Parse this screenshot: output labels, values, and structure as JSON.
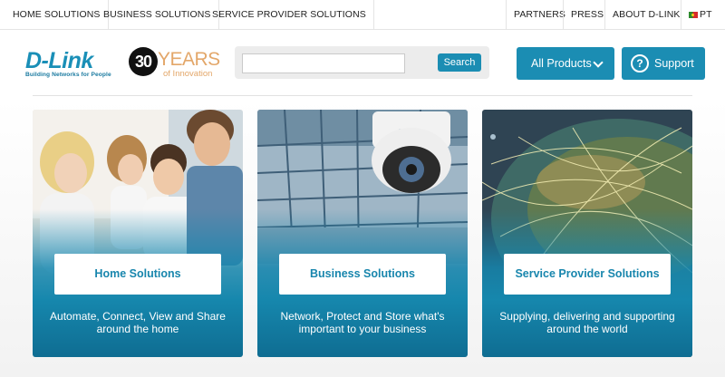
{
  "topnav": {
    "left": [
      "HOME SOLUTIONS",
      "BUSINESS SOLUTIONS",
      "SERVICE PROVIDER SOLUTIONS"
    ],
    "right": [
      "PARTNERS",
      "PRESS",
      "ABOUT D-LINK"
    ],
    "lang": "PT"
  },
  "header": {
    "logo": "D-Link",
    "tagline": "Building Networks for People",
    "anniv_number": "30",
    "anniv_years": "YEARS",
    "anniv_sub": "of Innovation",
    "search_button": "Search",
    "search_value": "",
    "all_products": "All Products",
    "support": "Support",
    "support_icon": "?"
  },
  "cards": [
    {
      "title": "Home Solutions",
      "desc": "Automate, Connect, View and Share around the home"
    },
    {
      "title": "Business Solutions",
      "desc": "Network, Protect and Store what's important to your business"
    },
    {
      "title": "Service Provider Solutions",
      "desc": "Supplying, delivering and supporting around the world"
    }
  ],
  "colors": {
    "accent": "#1b8db3",
    "gold": "#e3a76a"
  }
}
